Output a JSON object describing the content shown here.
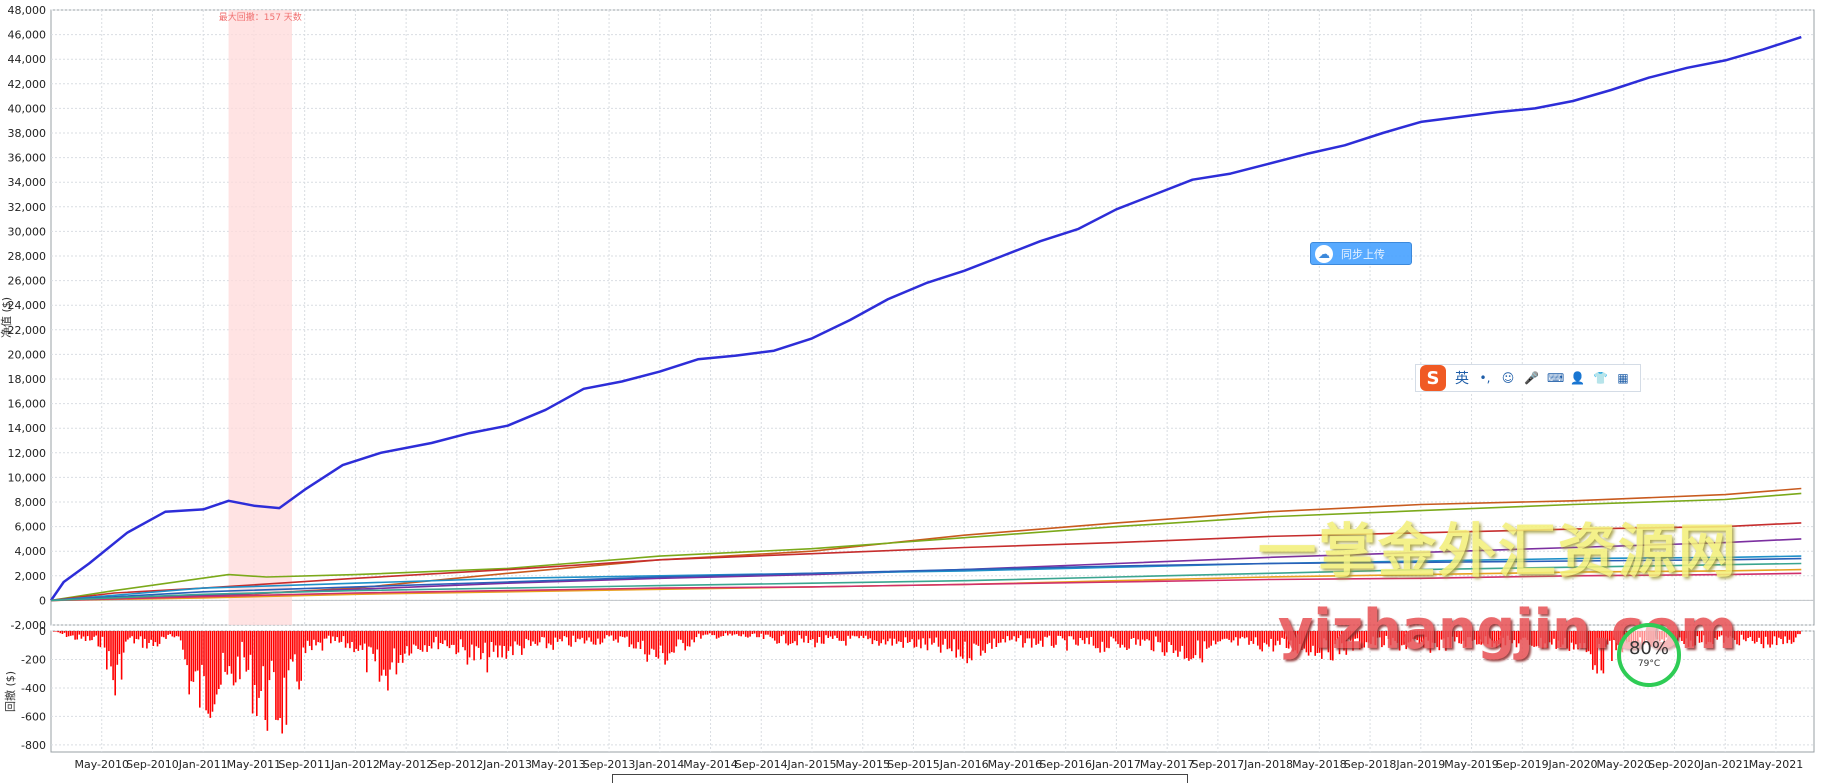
{
  "chart_data": [
    {
      "type": "line",
      "title": "",
      "xlabel": "",
      "ylabel": "净值 ($)",
      "ylim": [
        -2000,
        48000
      ],
      "yticks": [
        -2000,
        0,
        2000,
        4000,
        6000,
        8000,
        10000,
        12000,
        14000,
        16000,
        18000,
        20000,
        22000,
        24000,
        26000,
        28000,
        30000,
        32000,
        34000,
        36000,
        38000,
        40000,
        42000,
        44000,
        46000,
        48000
      ],
      "ytick_labels": [
        "-2,000",
        "0",
        "2,000",
        "4,000",
        "6,000",
        "8,000",
        "10,000",
        "12,000",
        "14,000",
        "16,000",
        "18,000",
        "20,000",
        "22,000",
        "24,000",
        "26,000",
        "28,000",
        "30,000",
        "32,000",
        "34,000",
        "36,000",
        "38,000",
        "40,000",
        "42,000",
        "44,000",
        "46,000",
        "48,000"
      ],
      "xlim": [
        "2010-01",
        "2021-08"
      ],
      "x_tick_labels": [
        "May-2010",
        "Sep-2010",
        "Jan-2011",
        "May-2011",
        "Sep-2011",
        "Jan-2012",
        "May-2012",
        "Sep-2012",
        "Jan-2013",
        "May-2013",
        "Sep-2013",
        "Jan-2014",
        "May-2014",
        "Sep-2014",
        "Jan-2015",
        "May-2015",
        "Sep-2015",
        "Jan-2016",
        "May-2016",
        "Sep-2016",
        "Jan-2017",
        "May-2017",
        "Sep-2017",
        "Jan-2018",
        "May-2018",
        "Sep-2018",
        "Jan-2019",
        "May-2019",
        "Sep-2019",
        "Jan-2020",
        "May-2020",
        "Sep-2020",
        "Jan-2021",
        "May-2021"
      ],
      "grid": true,
      "annotation": {
        "text": "最大回撤：157 天数",
        "from": "2011-03",
        "to": "2011-08"
      },
      "series": [
        {
          "color": "#2d2dd8",
          "x": [
            "2010-01",
            "2010-02",
            "2010-04",
            "2010-07",
            "2010-10",
            "2011-01",
            "2011-03",
            "2011-05",
            "2011-07",
            "2011-09",
            "2011-12",
            "2012-03",
            "2012-07",
            "2012-10",
            "2013-01",
            "2013-04",
            "2013-07",
            "2013-10",
            "2014-01",
            "2014-04",
            "2014-07",
            "2014-10",
            "2015-01",
            "2015-04",
            "2015-07",
            "2015-10",
            "2016-01",
            "2016-04",
            "2016-07",
            "2016-10",
            "2017-01",
            "2017-04",
            "2017-07",
            "2017-10",
            "2018-01",
            "2018-04",
            "2018-07",
            "2018-10",
            "2019-01",
            "2019-04",
            "2019-07",
            "2019-10",
            "2020-01",
            "2020-04",
            "2020-07",
            "2020-10",
            "2021-01",
            "2021-04",
            "2021-07"
          ],
          "values": [
            0,
            1500,
            3000,
            5500,
            7200,
            7400,
            8100,
            7700,
            7500,
            9000,
            11000,
            12000,
            12800,
            13600,
            14200,
            15500,
            17200,
            17800,
            18600,
            19600,
            19900,
            20300,
            21300,
            22800,
            24500,
            25800,
            26800,
            28000,
            29200,
            30200,
            31800,
            33000,
            34200,
            34700,
            35500,
            36300,
            37000,
            38000,
            38900,
            39300,
            39700,
            40000,
            40600,
            41500,
            42500,
            43300,
            43900,
            44800,
            45800
          ]
        },
        {
          "color": "#c85a1e",
          "x": [
            "2010-01",
            "2011-01",
            "2012-01",
            "2013-01",
            "2014-01",
            "2015-01",
            "2016-01",
            "2017-01",
            "2018-01",
            "2019-01",
            "2020-01",
            "2021-01",
            "2021-07"
          ],
          "values": [
            0,
            300,
            1000,
            2200,
            3300,
            4000,
            5300,
            6300,
            7200,
            7800,
            8100,
            8600,
            9100
          ]
        },
        {
          "color": "#7ba91a",
          "x": [
            "2010-01",
            "2010-06",
            "2011-03",
            "2011-06",
            "2012-01",
            "2013-01",
            "2014-01",
            "2015-01",
            "2016-01",
            "2017-01",
            "2018-01",
            "2019-01",
            "2020-01",
            "2021-01",
            "2021-07"
          ],
          "values": [
            0,
            800,
            2100,
            1900,
            2100,
            2600,
            3600,
            4200,
            5100,
            6000,
            6800,
            7300,
            7800,
            8200,
            8700
          ]
        },
        {
          "color": "#c62d2d",
          "x": [
            "2010-01",
            "2010-06",
            "2011-01",
            "2012-01",
            "2013-01",
            "2014-01",
            "2015-01",
            "2016-01",
            "2017-01",
            "2018-01",
            "2019-01",
            "2020-01",
            "2021-01",
            "2021-07"
          ],
          "values": [
            0,
            600,
            1000,
            1800,
            2500,
            3300,
            3800,
            4300,
            4700,
            5200,
            5500,
            5800,
            6000,
            6300
          ]
        },
        {
          "color": "#7b2fa0",
          "x": [
            "2010-01",
            "2011-01",
            "2012-01",
            "2013-01",
            "2014-01",
            "2015-01",
            "2016-01",
            "2017-01",
            "2018-01",
            "2019-01",
            "2020-01",
            "2021-01",
            "2021-07"
          ],
          "values": [
            0,
            400,
            900,
            1400,
            1800,
            2100,
            2500,
            3000,
            3500,
            3900,
            4300,
            4700,
            5000
          ]
        },
        {
          "color": "#1e90c8",
          "x": [
            "2010-01",
            "2011-01",
            "2012-01",
            "2013-01",
            "2014-01",
            "2015-01",
            "2016-01",
            "2017-01",
            "2018-01",
            "2019-01",
            "2020-01",
            "2021-01",
            "2021-07"
          ],
          "values": [
            0,
            1000,
            1400,
            1800,
            2000,
            2200,
            2400,
            2700,
            3000,
            3200,
            3400,
            3500,
            3600
          ]
        },
        {
          "color": "#2a5fb8",
          "x": [
            "2010-01",
            "2011-01",
            "2012-01",
            "2013-01",
            "2014-01",
            "2015-01",
            "2016-01",
            "2017-01",
            "2018-01",
            "2019-01",
            "2020-01",
            "2021-01",
            "2021-07"
          ],
          "values": [
            0,
            700,
            1100,
            1500,
            1900,
            2200,
            2500,
            2800,
            3000,
            3100,
            3200,
            3300,
            3400
          ]
        },
        {
          "color": "#e8a020",
          "x": [
            "2010-01",
            "2011-01",
            "2012-01",
            "2013-01",
            "2014-01",
            "2015-01",
            "2016-01",
            "2017-01",
            "2018-01",
            "2019-01",
            "2020-01",
            "2021-01",
            "2021-07"
          ],
          "values": [
            0,
            200,
            500,
            700,
            900,
            1100,
            1300,
            1600,
            1900,
            2100,
            2300,
            2400,
            2500
          ]
        },
        {
          "color": "#d0306a",
          "x": [
            "2010-01",
            "2011-01",
            "2012-01",
            "2013-01",
            "2014-01",
            "2015-01",
            "2016-01",
            "2017-01",
            "2018-01",
            "2019-01",
            "2020-01",
            "2021-01",
            "2021-07"
          ],
          "values": [
            0,
            300,
            600,
            800,
            1000,
            1100,
            1300,
            1500,
            1700,
            1800,
            2000,
            2100,
            2200
          ]
        },
        {
          "color": "#3aa590",
          "x": [
            "2010-01",
            "2011-01",
            "2012-01",
            "2013-01",
            "2014-01",
            "2015-01",
            "2016-01",
            "2017-01",
            "2018-01",
            "2019-01",
            "2020-01",
            "2021-01",
            "2021-07"
          ],
          "values": [
            0,
            500,
            800,
            1000,
            1200,
            1400,
            1600,
            1900,
            2200,
            2500,
            2700,
            2900,
            3000
          ]
        }
      ]
    },
    {
      "type": "bar",
      "title": "",
      "xlabel": "",
      "ylabel": "回撤 ($)",
      "ylim": [
        -850,
        0
      ],
      "yticks": [
        0,
        -200,
        -400,
        -600,
        -800
      ],
      "ytick_labels": [
        "0",
        "-200",
        "-400",
        "-600",
        "-800"
      ],
      "color": "#ff0000",
      "drawdown_points": [
        [
          "2010-01",
          0
        ],
        [
          "2010-03",
          -80
        ],
        [
          "2010-05",
          -120
        ],
        [
          "2010-06",
          -600
        ],
        [
          "2010-07",
          -90
        ],
        [
          "2010-09",
          -150
        ],
        [
          "2010-11",
          -40
        ],
        [
          "2010-12",
          -600
        ],
        [
          "2011-01",
          -700
        ],
        [
          "2011-02",
          -550
        ],
        [
          "2011-03",
          -600
        ],
        [
          "2011-04",
          -300
        ],
        [
          "2011-05",
          -640
        ],
        [
          "2011-06",
          -760
        ],
        [
          "2011-07",
          -820
        ],
        [
          "2011-08",
          -690
        ],
        [
          "2011-09",
          -250
        ],
        [
          "2011-11",
          -120
        ],
        [
          "2012-01",
          -160
        ],
        [
          "2012-03",
          -540
        ],
        [
          "2012-05",
          -180
        ],
        [
          "2012-08",
          -120
        ],
        [
          "2012-11",
          -320
        ],
        [
          "2013-01",
          -200
        ],
        [
          "2013-04",
          -150
        ],
        [
          "2013-07",
          -110
        ],
        [
          "2013-10",
          -80
        ],
        [
          "2014-01",
          -300
        ],
        [
          "2014-04",
          -60
        ],
        [
          "2014-07",
          -50
        ],
        [
          "2014-10",
          -90
        ],
        [
          "2015-01",
          -120
        ],
        [
          "2015-05",
          -100
        ],
        [
          "2015-09",
          -140
        ],
        [
          "2016-01",
          -240
        ],
        [
          "2016-04",
          -110
        ],
        [
          "2016-08",
          -130
        ],
        [
          "2016-12",
          -160
        ],
        [
          "2017-03",
          -120
        ],
        [
          "2017-07",
          -250
        ],
        [
          "2017-10",
          -130
        ],
        [
          "2018-02",
          -160
        ],
        [
          "2018-06",
          -210
        ],
        [
          "2018-09",
          -120
        ],
        [
          "2019-01",
          -170
        ],
        [
          "2019-05",
          -110
        ],
        [
          "2019-09",
          -130
        ],
        [
          "2020-01",
          -150
        ],
        [
          "2020-03",
          -330
        ],
        [
          "2020-05",
          -170
        ],
        [
          "2020-09",
          -120
        ],
        [
          "2021-01",
          -90
        ],
        [
          "2021-05",
          -140
        ],
        [
          "2021-07",
          -60
        ]
      ]
    }
  ],
  "overlays": {
    "cloud_button_label": "同步上传",
    "ime_logo": "S",
    "ime_lang": "英",
    "ime_tools": [
      "•,",
      "☺",
      "🎤",
      "⌨",
      "👤",
      "👕",
      "▦"
    ],
    "watermark_cn": "一掌金外汇资源网",
    "watermark_en": "yizhangjin.com",
    "gauge_percent": "80%",
    "gauge_temp": "79°C"
  }
}
